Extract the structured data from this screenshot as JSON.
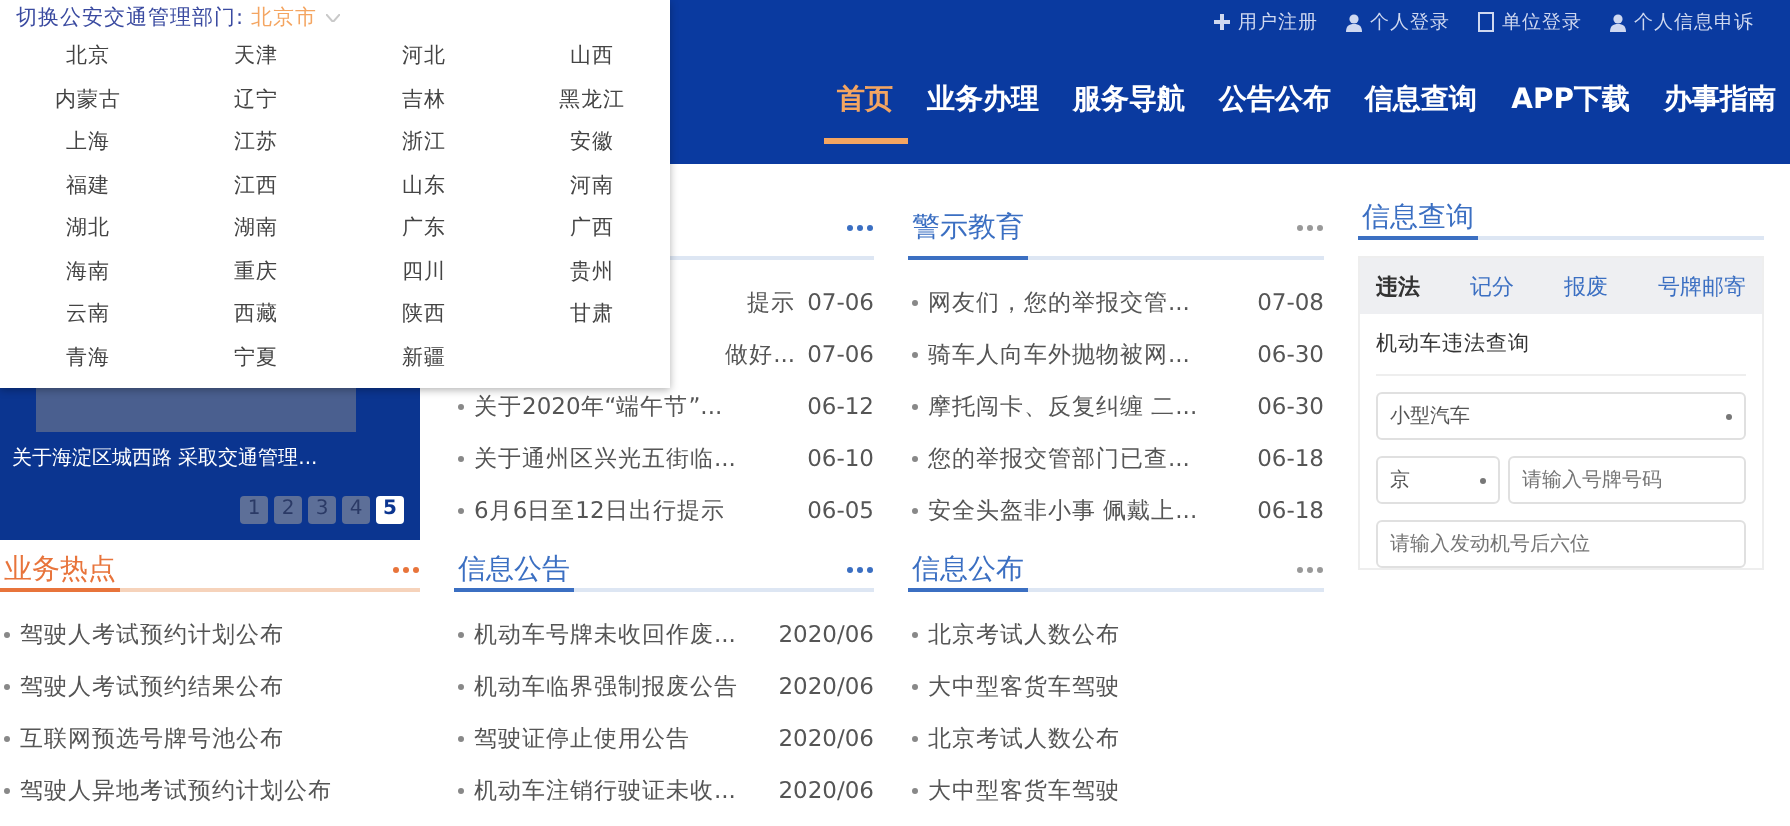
{
  "top_links": [
    {
      "label": "用户注册",
      "kind": "plus"
    },
    {
      "label": "个人登录",
      "kind": "person"
    },
    {
      "label": "单位登录",
      "kind": "document"
    },
    {
      "label": "个人信息申诉",
      "kind": "person"
    }
  ],
  "nav": [
    {
      "label": "首页",
      "selected": true
    },
    {
      "label": "业务办理",
      "selected": false
    },
    {
      "label": "服务导航",
      "selected": false
    },
    {
      "label": "公告公布",
      "selected": false
    },
    {
      "label": "信息查询",
      "selected": false
    },
    {
      "label": "APP下载",
      "selected": false
    },
    {
      "label": "办事指南",
      "selected": false
    }
  ],
  "region_switcher": {
    "label": "切换公安交通管理部门:",
    "current": "北京市",
    "regions": [
      "北京",
      "天津",
      "河北",
      "山西",
      "内蒙古",
      "辽宁",
      "吉林",
      "黑龙江",
      "上海",
      "江苏",
      "浙江",
      "安徽",
      "福建",
      "江西",
      "山东",
      "河南",
      "湖北",
      "湖南",
      "广东",
      "广西",
      "海南",
      "重庆",
      "四川",
      "贵州",
      "云南",
      "西藏",
      "陕西",
      "甘肃",
      "青海",
      "宁夏",
      "新疆"
    ]
  },
  "banner": {
    "caption": "关于海淀区城西路 采取交通管理...",
    "pages": [
      {
        "label": "1",
        "selected": false
      },
      {
        "label": "2",
        "selected": false
      },
      {
        "label": "3",
        "selected": false
      },
      {
        "label": "4",
        "selected": false
      },
      {
        "label": "5",
        "selected": true
      }
    ]
  },
  "notices": {
    "items": [
      {
        "title": "提示",
        "date": "07-06",
        "kind": "covered"
      },
      {
        "title": "做好...",
        "date": "07-06",
        "kind": "covered"
      },
      {
        "title": "关于2020年“端午节”...",
        "date": "06-12",
        "kind": "normal"
      },
      {
        "title": "关于通州区兴光五街临...",
        "date": "06-10",
        "kind": "normal"
      },
      {
        "title": "6月6日至12日出行提示",
        "date": "06-05",
        "kind": "normal"
      }
    ]
  },
  "warning_education": {
    "title": "警示教育",
    "items": [
      {
        "title": "网友们，您的举报交管...",
        "date": "07-08"
      },
      {
        "title": "骑车人向车外抛物被网...",
        "date": "06-30"
      },
      {
        "title": "摩托闯卡、反复纠缠 二...",
        "date": "06-30"
      },
      {
        "title": "您的举报交管部门已查...",
        "date": "06-18"
      },
      {
        "title": "安全头盔非小事 佩戴上...",
        "date": "06-18"
      }
    ]
  },
  "info_query": {
    "title": "信息查询",
    "tabs": [
      {
        "label": "违法",
        "selected": true
      },
      {
        "label": "记分",
        "selected": false
      },
      {
        "label": "报废",
        "selected": false
      },
      {
        "label": "号牌邮寄",
        "selected": false
      }
    ],
    "subtitle": "机动车违法查询",
    "vehicle_type": "小型汽车",
    "province": "京",
    "plate_placeholder": "请输入号牌号码",
    "engine_placeholder": "请输入发动机号后六位"
  },
  "business_hotspots": {
    "title": "业务热点",
    "items": [
      {
        "title": "驾驶人考试预约计划公布"
      },
      {
        "title": "驾驶人考试预约结果公布"
      },
      {
        "title": "互联网预选号牌号池公布"
      },
      {
        "title": "驾驶人异地考试预约计划公布"
      }
    ]
  },
  "info_notices": {
    "title": "信息公告",
    "items": [
      {
        "title": "机动车号牌未收回作废...",
        "date": "2020/06"
      },
      {
        "title": "机动车临界强制报废公告",
        "date": "2020/06"
      },
      {
        "title": "驾驶证停止使用公告",
        "date": "2020/06"
      },
      {
        "title": "机动车注销行驶证未收...",
        "date": "2020/06"
      }
    ]
  },
  "info_publish": {
    "title": "信息公布",
    "items": [
      {
        "title": "北京考试人数公布"
      },
      {
        "title": "大中型客货车驾驶"
      },
      {
        "title": "北京考试人数公布"
      },
      {
        "title": "大中型客货车驾驶"
      }
    ]
  }
}
